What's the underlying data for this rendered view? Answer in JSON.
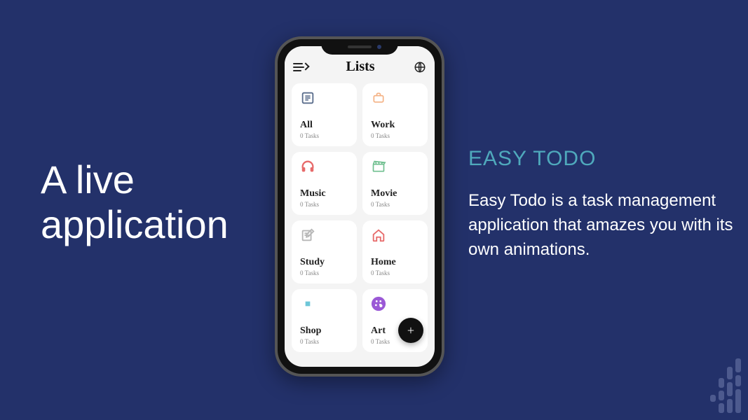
{
  "left": {
    "heading_line1": "A live",
    "heading_line2": "application"
  },
  "right": {
    "title": "EASY TODO",
    "description": "Easy Todo is a task management application that amazes you with its own animations."
  },
  "app": {
    "header_title": "Lists",
    "fab_label": "+",
    "cards": [
      {
        "title": "All",
        "sub": "0 Tasks",
        "icon": "list-icon",
        "color": "#5a6d8c"
      },
      {
        "title": "Work",
        "sub": "0 Tasks",
        "icon": "briefcase-icon",
        "color": "#f4b183"
      },
      {
        "title": "Music",
        "sub": "0 Tasks",
        "icon": "headphones-icon",
        "color": "#e76a6a"
      },
      {
        "title": "Movie",
        "sub": "0 Tasks",
        "icon": "clapperboard-icon",
        "color": "#6fbf8f"
      },
      {
        "title": "Study",
        "sub": "0 Tasks",
        "icon": "notebook-icon",
        "color": "#b7b7b7"
      },
      {
        "title": "Home",
        "sub": "0 Tasks",
        "icon": "house-icon",
        "color": "#e76a6a"
      },
      {
        "title": "Shop",
        "sub": "0 Tasks",
        "icon": "square-icon",
        "color": "#6ec7d8"
      },
      {
        "title": "Art",
        "sub": "0 Tasks",
        "icon": "palette-icon",
        "color": "#9b59d6"
      }
    ]
  }
}
